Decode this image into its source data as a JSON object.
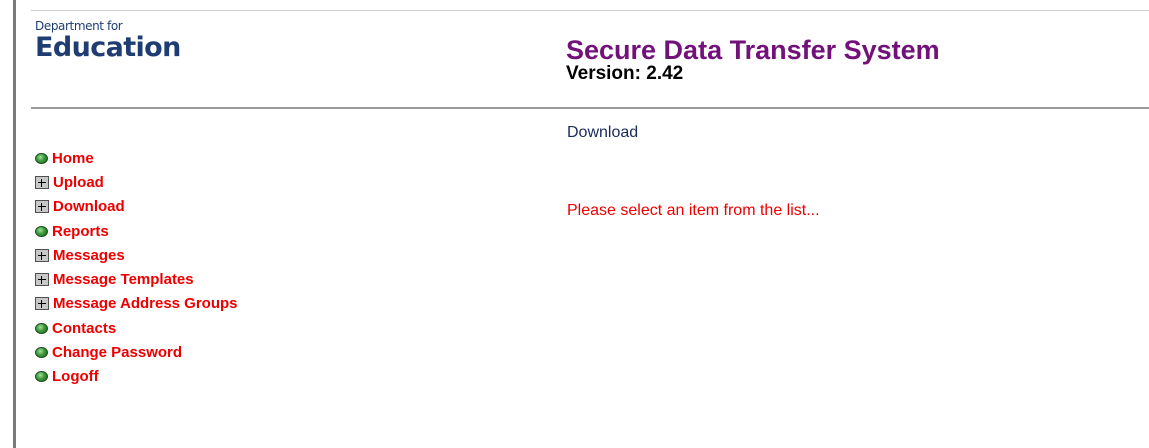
{
  "logo": {
    "line1": "Department for",
    "line2": "Education"
  },
  "header": {
    "title": "Secure Data Transfer System",
    "version": "Version: 2.42"
  },
  "nav": {
    "items": [
      {
        "label": "Home",
        "icon": "bullet-icon"
      },
      {
        "label": "Upload",
        "icon": "expand-icon"
      },
      {
        "label": "Download",
        "icon": "expand-icon"
      },
      {
        "label": "Reports",
        "icon": "bullet-icon"
      },
      {
        "label": "Messages",
        "icon": "expand-icon"
      },
      {
        "label": "Message Templates",
        "icon": "expand-icon"
      },
      {
        "label": "Message Address Groups",
        "icon": "expand-icon"
      },
      {
        "label": "Contacts",
        "icon": "bullet-icon"
      },
      {
        "label": "Change Password",
        "icon": "bullet-icon"
      },
      {
        "label": "Logoff",
        "icon": "bullet-icon"
      }
    ]
  },
  "main": {
    "breadcrumb": "Download",
    "message": "Please select an item from the list..."
  },
  "colors": {
    "title": "#73117a",
    "nav_text": "#ee0000",
    "logo": "#1f3d73",
    "message": "#ee0000"
  }
}
